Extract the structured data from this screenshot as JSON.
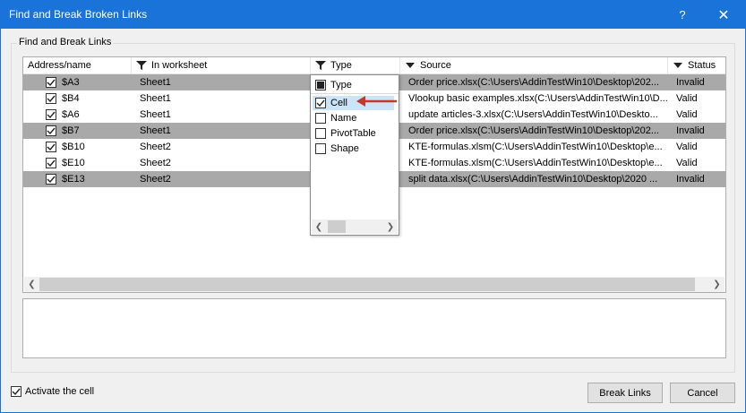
{
  "window": {
    "title": "Find and Break Broken Links",
    "help": "?",
    "close": "✕"
  },
  "group_label": "Find and Break Links",
  "columns": [
    "Address/name",
    "In worksheet",
    "Type",
    "Source",
    "Status"
  ],
  "rows": [
    {
      "address": "$A3",
      "sheet": "Sheet1",
      "source": "Order price.xlsx(C:\\Users\\AddinTestWin10\\Desktop\\202...",
      "status": "Invalid",
      "selected": true
    },
    {
      "address": "$B4",
      "sheet": "Sheet1",
      "source": "Vlookup basic examples.xlsx(C:\\Users\\AddinTestWin10\\D...",
      "status": "Valid",
      "selected": false
    },
    {
      "address": "$A6",
      "sheet": "Sheet1",
      "source": "update articles-3.xlsx(C:\\Users\\AddinTestWin10\\Deskto...",
      "status": "Valid",
      "selected": false
    },
    {
      "address": "$B7",
      "sheet": "Sheet1",
      "source": "Order price.xlsx(C:\\Users\\AddinTestWin10\\Desktop\\202...",
      "status": "Invalid",
      "selected": true
    },
    {
      "address": "$B10",
      "sheet": "Sheet2",
      "source": "KTE-formulas.xlsm(C:\\Users\\AddinTestWin10\\Desktop\\e...",
      "status": "Valid",
      "selected": false
    },
    {
      "address": "$E10",
      "sheet": "Sheet2",
      "source": "KTE-formulas.xlsm(C:\\Users\\AddinTestWin10\\Desktop\\e...",
      "status": "Valid",
      "selected": false
    },
    {
      "address": "$E13",
      "sheet": "Sheet2",
      "source": "split data.xlsx(C:\\Users\\AddinTestWin10\\Desktop\\2020 ...",
      "status": "Invalid",
      "selected": true
    }
  ],
  "type_filter": {
    "header": "Type",
    "options": [
      {
        "label": "Cell",
        "checked": true
      },
      {
        "label": "Name",
        "checked": false
      },
      {
        "label": "PivotTable",
        "checked": false
      },
      {
        "label": "Shape",
        "checked": false
      }
    ]
  },
  "activate_cell": {
    "label": "Activate the cell",
    "checked": true
  },
  "buttons": {
    "break": "Break Links",
    "cancel": "Cancel"
  },
  "colors": {
    "title_bar": "#1a73d9",
    "selected_row": "#a9a9a9",
    "arrow": "#c0392b"
  }
}
